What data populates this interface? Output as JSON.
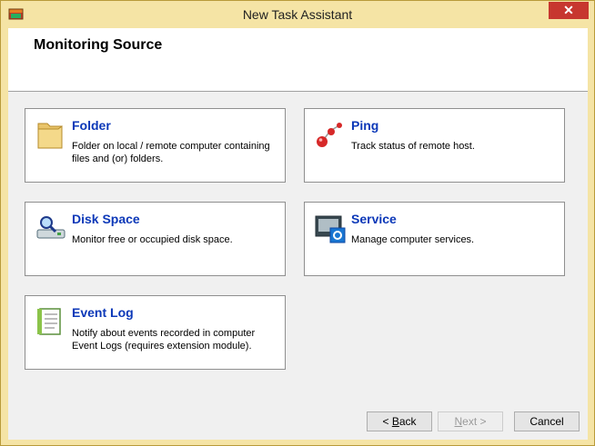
{
  "window": {
    "title": "New Task Assistant",
    "close_glyph": "✕"
  },
  "header": {
    "title": "Monitoring Source"
  },
  "cards": [
    {
      "title": "Folder",
      "description": "Folder on local / remote computer containing files and (or) folders.",
      "icon": "folder-icon"
    },
    {
      "title": "Ping",
      "description": "Track status of remote host.",
      "icon": "ping-icon"
    },
    {
      "title": "Disk Space",
      "description": "Monitor free or occupied disk space.",
      "icon": "disk-space-icon"
    },
    {
      "title": "Service",
      "description": "Manage computer services.",
      "icon": "service-icon"
    },
    {
      "title": "Event Log",
      "description": "Notify about events recorded in computer Event Logs (requires extension module).",
      "icon": "event-log-icon"
    }
  ],
  "buttons": {
    "back": {
      "prefix": "< ",
      "accel": "B",
      "rest": "ack",
      "enabled": true
    },
    "next": {
      "accel": "N",
      "rest": "ext",
      "suffix": " >",
      "enabled": false
    },
    "cancel": {
      "label": "Cancel",
      "enabled": true
    }
  },
  "colors": {
    "frame": "#f5e4a5",
    "close": "#c7372f",
    "card_title": "#0c38b8"
  }
}
